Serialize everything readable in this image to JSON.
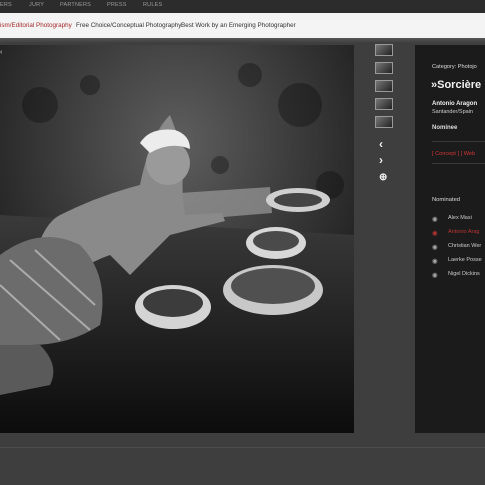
{
  "nav": {
    "items": [
      "ERS",
      "JURY",
      "PARTNERS",
      "PRESS",
      "RULES"
    ]
  },
  "tabs": [
    {
      "label": "ism/Editorial Photography",
      "active": true
    },
    {
      "label": "Free Choice/Conceptual Photography",
      "active": false
    },
    {
      "label": "Best Work by an Emerging Photographer",
      "active": false
    }
  ],
  "photo": {
    "corner_text": "‹"
  },
  "panel": {
    "category": "Category: Photojo",
    "title": "»Sorcière",
    "author": "Antonio Aragon",
    "location": "Santander/Spain",
    "status": "Nominee",
    "links": "[ Concept ] [ Web",
    "nominated_heading": "Nominated",
    "nominated": [
      {
        "name": "Alex Masi",
        "active": false
      },
      {
        "name": "Antonio Arag",
        "active": true
      },
      {
        "name": "Christian Wer",
        "active": false
      },
      {
        "name": "Laerke Posse",
        "active": false
      },
      {
        "name": "Nigel Dickins",
        "active": false
      }
    ]
  },
  "icons": {
    "prev": "chevron-left-icon",
    "next": "chevron-right-icon",
    "zoom": "zoom-in-icon",
    "eye": "eye-icon"
  },
  "colors": {
    "accent": "#b83434",
    "panel_bg": "#1b1b1b",
    "page_bg": "#3e3e3e"
  }
}
